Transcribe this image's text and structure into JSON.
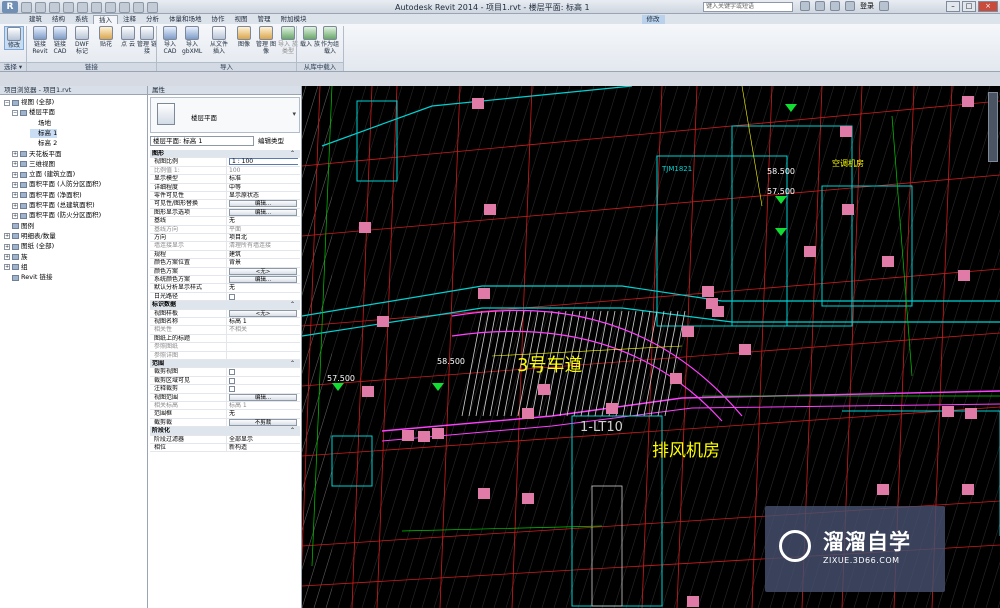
{
  "window": {
    "title": "Autodesk Revit 2014 -     项目1.rvt - 楼层平面: 标高 1",
    "app_logo": "R",
    "search_placeholder": "键入关键字或短语",
    "user": "登录"
  },
  "tabs": [
    "建筑",
    "结构",
    "系统",
    "插入",
    "注释",
    "分析",
    "体量和场地",
    "协作",
    "视图",
    "管理",
    "附加模块",
    "修改"
  ],
  "active_tab": "插入",
  "ribbon": {
    "buttons": [
      {
        "label": "修改",
        "icon": "cursor-icon"
      },
      {
        "label": "链接 Revit",
        "icon": "link-revit-icon"
      },
      {
        "label": "链接 CAD",
        "icon": "link-cad-icon"
      },
      {
        "label": "DWF 标记",
        "icon": "dwf-icon"
      },
      {
        "label": "贴花",
        "icon": "decal-icon"
      },
      {
        "label": "点 云",
        "icon": "point-cloud-icon"
      },
      {
        "label": "管理 链接",
        "icon": "manage-links-icon"
      },
      {
        "label": "导入 CAD",
        "icon": "import-cad-icon"
      },
      {
        "label": "导入 gbXML",
        "icon": "import-gbxml-icon"
      },
      {
        "label": "从文件 插入",
        "icon": "insert-file-icon"
      },
      {
        "label": "图像",
        "icon": "image-icon"
      },
      {
        "label": "管理 图像",
        "icon": "manage-image-icon"
      },
      {
        "label": "导入 族类型",
        "icon": "import-family-types-icon"
      },
      {
        "label": "载入 族",
        "icon": "load-family-icon"
      },
      {
        "label": "作为组 载入",
        "icon": "load-group-icon"
      }
    ],
    "panels": [
      "选择 ▾",
      "链接",
      "导入",
      "从库中载入"
    ]
  },
  "project_browser": {
    "title": "项目浏览器 - 项目1.rvt",
    "nodes": [
      {
        "label": "视图 (全部)",
        "exp": "−"
      },
      {
        "label": "楼层平面",
        "exp": "−"
      },
      {
        "label": "场地",
        "exp": ""
      },
      {
        "label": "标高 1",
        "exp": ""
      },
      {
        "label": "标高 2",
        "exp": ""
      },
      {
        "label": "天花板平面",
        "exp": "+"
      },
      {
        "label": "三维视图",
        "exp": "+"
      },
      {
        "label": "立面 (建筑立面)",
        "exp": "+"
      },
      {
        "label": "面积平面 (人防分区面积)",
        "exp": "+"
      },
      {
        "label": "面积平面 (净面积)",
        "exp": "+"
      },
      {
        "label": "面积平面 (总建筑面积)",
        "exp": "+"
      },
      {
        "label": "面积平面 (防火分区面积)",
        "exp": "+"
      },
      {
        "label": "图例",
        "exp": ""
      },
      {
        "label": "明细表/数量",
        "exp": "+"
      },
      {
        "label": "图纸 (全部)",
        "exp": "+"
      },
      {
        "label": "族",
        "exp": "+"
      },
      {
        "label": "组",
        "exp": "+"
      },
      {
        "label": "Revit 链接",
        "exp": ""
      }
    ]
  },
  "properties": {
    "title": "属性",
    "type_name": "楼层平面",
    "instance": "楼层平面: 标高 1",
    "edit_type": "编辑类型",
    "rows": [
      {
        "k": "图形",
        "v": "⌃",
        "g": true
      },
      {
        "k": "视图比例",
        "v": "1 : 100",
        "in": true
      },
      {
        "k": "比例值 1:",
        "v": "100",
        "grey": true
      },
      {
        "k": "显示模型",
        "v": "标准"
      },
      {
        "k": "详细程度",
        "v": "中等"
      },
      {
        "k": "零件可见性",
        "v": "显示原状态"
      },
      {
        "k": "可见性/图形替换",
        "v": "编辑...",
        "btn": true
      },
      {
        "k": "图形显示选项",
        "v": "编辑...",
        "btn": true
      },
      {
        "k": "基线",
        "v": "无"
      },
      {
        "k": "基线方向",
        "v": "平面",
        "grey": true
      },
      {
        "k": "方向",
        "v": "项目北"
      },
      {
        "k": "墙连接显示",
        "v": "清理所有墙连接",
        "grey": true
      },
      {
        "k": "规程",
        "v": "建筑"
      },
      {
        "k": "颜色方案位置",
        "v": "背景"
      },
      {
        "k": "颜色方案",
        "v": "<无>",
        "btn": true
      },
      {
        "k": "系统颜色方案",
        "v": "编辑...",
        "btn": true
      },
      {
        "k": "默认分析显示样式",
        "v": "无"
      },
      {
        "k": "日光路径",
        "v": "",
        "cb": true
      },
      {
        "k": "标识数据",
        "v": "⌃",
        "g": true
      },
      {
        "k": "视图样板",
        "v": "<无>",
        "btn": true
      },
      {
        "k": "视图名称",
        "v": "标高 1"
      },
      {
        "k": "相关性",
        "v": "不相关",
        "grey": true
      },
      {
        "k": "图纸上的标题",
        "v": ""
      },
      {
        "k": "参照图纸",
        "v": "",
        "grey": true
      },
      {
        "k": "参照详图",
        "v": "",
        "grey": true
      },
      {
        "k": "范围",
        "v": "⌃",
        "g": true
      },
      {
        "k": "裁剪视图",
        "v": "",
        "cb": true
      },
      {
        "k": "裁剪区域可见",
        "v": "",
        "cb": true
      },
      {
        "k": "注释裁剪",
        "v": "",
        "cb": true
      },
      {
        "k": "视图范围",
        "v": "编辑...",
        "btn": true
      },
      {
        "k": "相关标高",
        "v": "标高 1",
        "grey": true
      },
      {
        "k": "范围框",
        "v": "无"
      },
      {
        "k": "截剪裁",
        "v": "不剪裁",
        "btn": true
      },
      {
        "k": "阶段化",
        "v": "⌃",
        "g": true
      },
      {
        "k": "阶段过滤器",
        "v": "全部显示"
      },
      {
        "k": "相位",
        "v": "新构造"
      }
    ]
  },
  "drawing": {
    "texts": [
      "3号车道",
      "排风机房",
      "1-LT10",
      "58.500",
      "57.500",
      "58.500",
      "57.500",
      "TJM1821",
      "空调机房"
    ],
    "colors": {
      "bg": "#000000",
      "grid": "#d01c1c",
      "wall": "#00d2d2",
      "hatch": "#cfcfcf",
      "anno": "#ffff00",
      "dim": "#00cc00",
      "col": "#e07aa6",
      "mag": "#ff40ff"
    }
  },
  "watermark": {
    "title": "溜溜自学",
    "sub": "ZIXUE.3D66.COM"
  }
}
